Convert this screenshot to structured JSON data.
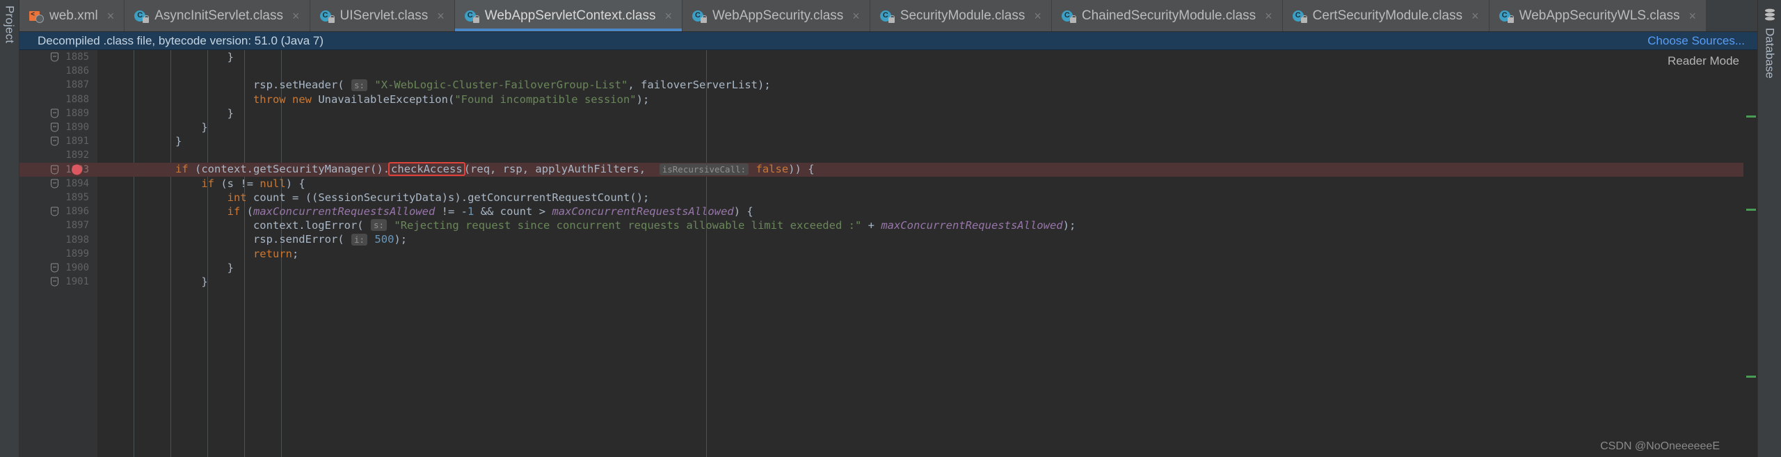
{
  "window": {
    "left_tool_label": "Project",
    "right_tool_label": "Database",
    "watermark": "CSDN @NoOneeeeeeE"
  },
  "tabbar": {
    "tabs": [
      {
        "label": "web.xml",
        "icon": "xml-file-icon",
        "active": false,
        "close": "×"
      },
      {
        "label": "AsyncInitServlet.class",
        "icon": "class-file-icon",
        "active": false,
        "close": "×"
      },
      {
        "label": "UIServlet.class",
        "icon": "class-file-icon",
        "active": false,
        "close": "×"
      },
      {
        "label": "WebAppServletContext.class",
        "icon": "class-file-icon",
        "active": true,
        "close": "×"
      },
      {
        "label": "WebAppSecurity.class",
        "icon": "class-file-icon",
        "active": false,
        "close": "×"
      },
      {
        "label": "SecurityModule.class",
        "icon": "class-file-icon",
        "active": false,
        "close": "×"
      },
      {
        "label": "ChainedSecurityModule.class",
        "icon": "class-file-icon",
        "active": false,
        "close": "×"
      },
      {
        "label": "CertSecurityModule.class",
        "icon": "class-file-icon",
        "active": false,
        "close": "×"
      },
      {
        "label": "WebAppSecurityWLS.class",
        "icon": "class-file-icon",
        "active": false,
        "close": "×"
      }
    ]
  },
  "notification": {
    "message": "Decompiled .class file, bytecode version: 51.0 (Java 7)",
    "action_label": "Choose Sources...",
    "background": "#1e3c58",
    "link_color": "#589df6"
  },
  "editor": {
    "reader_mode_label": "Reader Mode",
    "first_line": 1885,
    "highlighted_line": 1893,
    "breakpoint_line": 1893,
    "fold_lines": [
      1885,
      1889,
      1890,
      1891,
      1893,
      1894,
      1896,
      1900,
      1901
    ],
    "highlight_color": "#4e3434",
    "breakpoint_color": "#db5860",
    "focus_box_color": "#e2423c",
    "lines": [
      {
        "n": 1885,
        "text": "                    }"
      },
      {
        "n": 1886,
        "text": ""
      },
      {
        "n": 1887,
        "text": "                        rsp.setHeader( s: \"X-WebLogic-Cluster-FailoverGroup-List\", failoverServerList);"
      },
      {
        "n": 1888,
        "text": "                        throw new UnavailableException(\"Found incompatible session\");"
      },
      {
        "n": 1889,
        "text": "                    }"
      },
      {
        "n": 1890,
        "text": "                }"
      },
      {
        "n": 1891,
        "text": "            }"
      },
      {
        "n": 1892,
        "text": ""
      },
      {
        "n": 1893,
        "text": "            if (context.getSecurityManager().checkAccess(req, rsp, applyAuthFilters,  isRecursiveCall: false)) {"
      },
      {
        "n": 1894,
        "text": "                if (s != null) {"
      },
      {
        "n": 1895,
        "text": "                    int count = ((SessionSecurityData)s).getConcurrentRequestCount();"
      },
      {
        "n": 1896,
        "text": "                    if (maxConcurrentRequestsAllowed != -1 && count > maxConcurrentRequestsAllowed) {"
      },
      {
        "n": 1897,
        "text": "                        context.logError( s: \"Rejecting request since concurrent requests allowable limit exceeded :\" + maxConcurrentRequestsAllowed);"
      },
      {
        "n": 1898,
        "text": "                        rsp.sendError( i: 500);"
      },
      {
        "n": 1899,
        "text": "                        return;"
      },
      {
        "n": 1900,
        "text": "                    }"
      },
      {
        "n": 1901,
        "text": "                }"
      }
    ],
    "inline_hints": [
      {
        "line": 1887,
        "label": "s:"
      },
      {
        "line": 1893,
        "label": "isRecursiveCall:"
      },
      {
        "line": 1897,
        "label": "s:"
      },
      {
        "line": 1898,
        "label": "i:"
      }
    ],
    "focus_symbol": "checkAccess",
    "colors": {
      "keyword": "#cc7832",
      "string": "#6a8759",
      "number": "#6897bb",
      "field": "#9876aa",
      "plain": "#a9b7c6",
      "background": "#2b2b2b",
      "gutter": "#313335"
    },
    "markers": [
      {
        "top_pct": 16,
        "color": "#499c54"
      },
      {
        "top_pct": 39,
        "color": "#499c54"
      },
      {
        "top_pct": 80,
        "color": "#499c54"
      }
    ]
  }
}
